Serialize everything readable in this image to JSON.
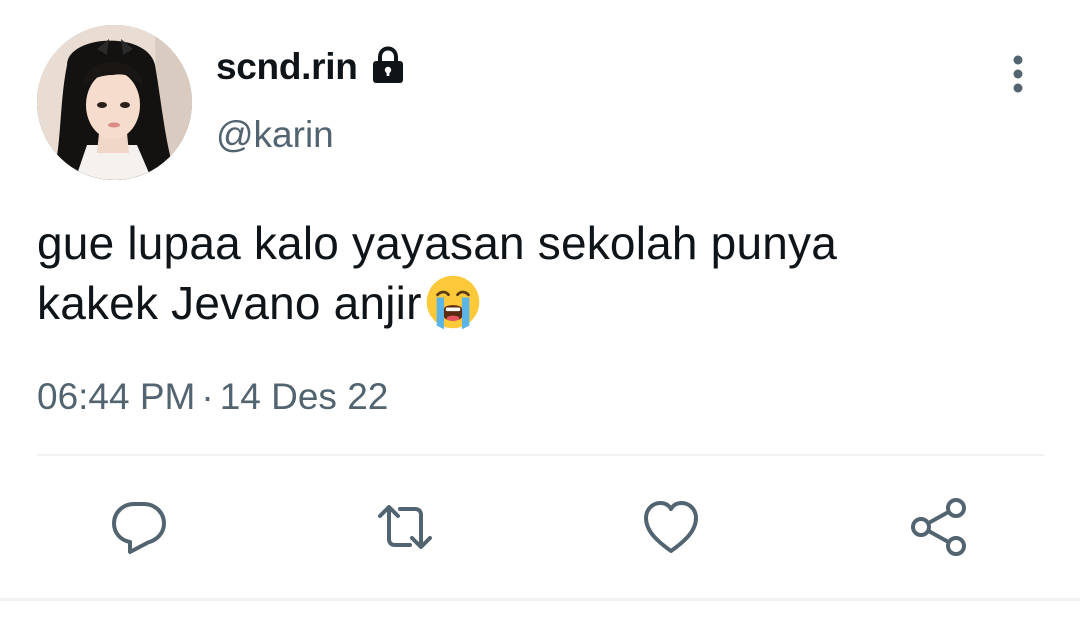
{
  "tweet": {
    "display_name": "scnd.rin",
    "handle": "@karin",
    "text_line_1": "gue lupaa kalo yayasan sekolah punya",
    "text_line_2": "kakek Jevano anjir",
    "emoji": "loudly-crying-face",
    "time": "06:44 PM",
    "separator": "·",
    "date": "14 Des 22",
    "protected_account": true
  },
  "icons": {
    "lock": "lock-icon",
    "more": "more-vertical-icon",
    "reply": "reply-icon",
    "retweet": "retweet-icon",
    "like": "heart-icon",
    "share": "share-icon"
  },
  "colors": {
    "text_primary": "#0f1419",
    "text_secondary": "#536471",
    "icon_gray": "#536471",
    "divider": "#eff3f4",
    "background": "#ffffff"
  }
}
